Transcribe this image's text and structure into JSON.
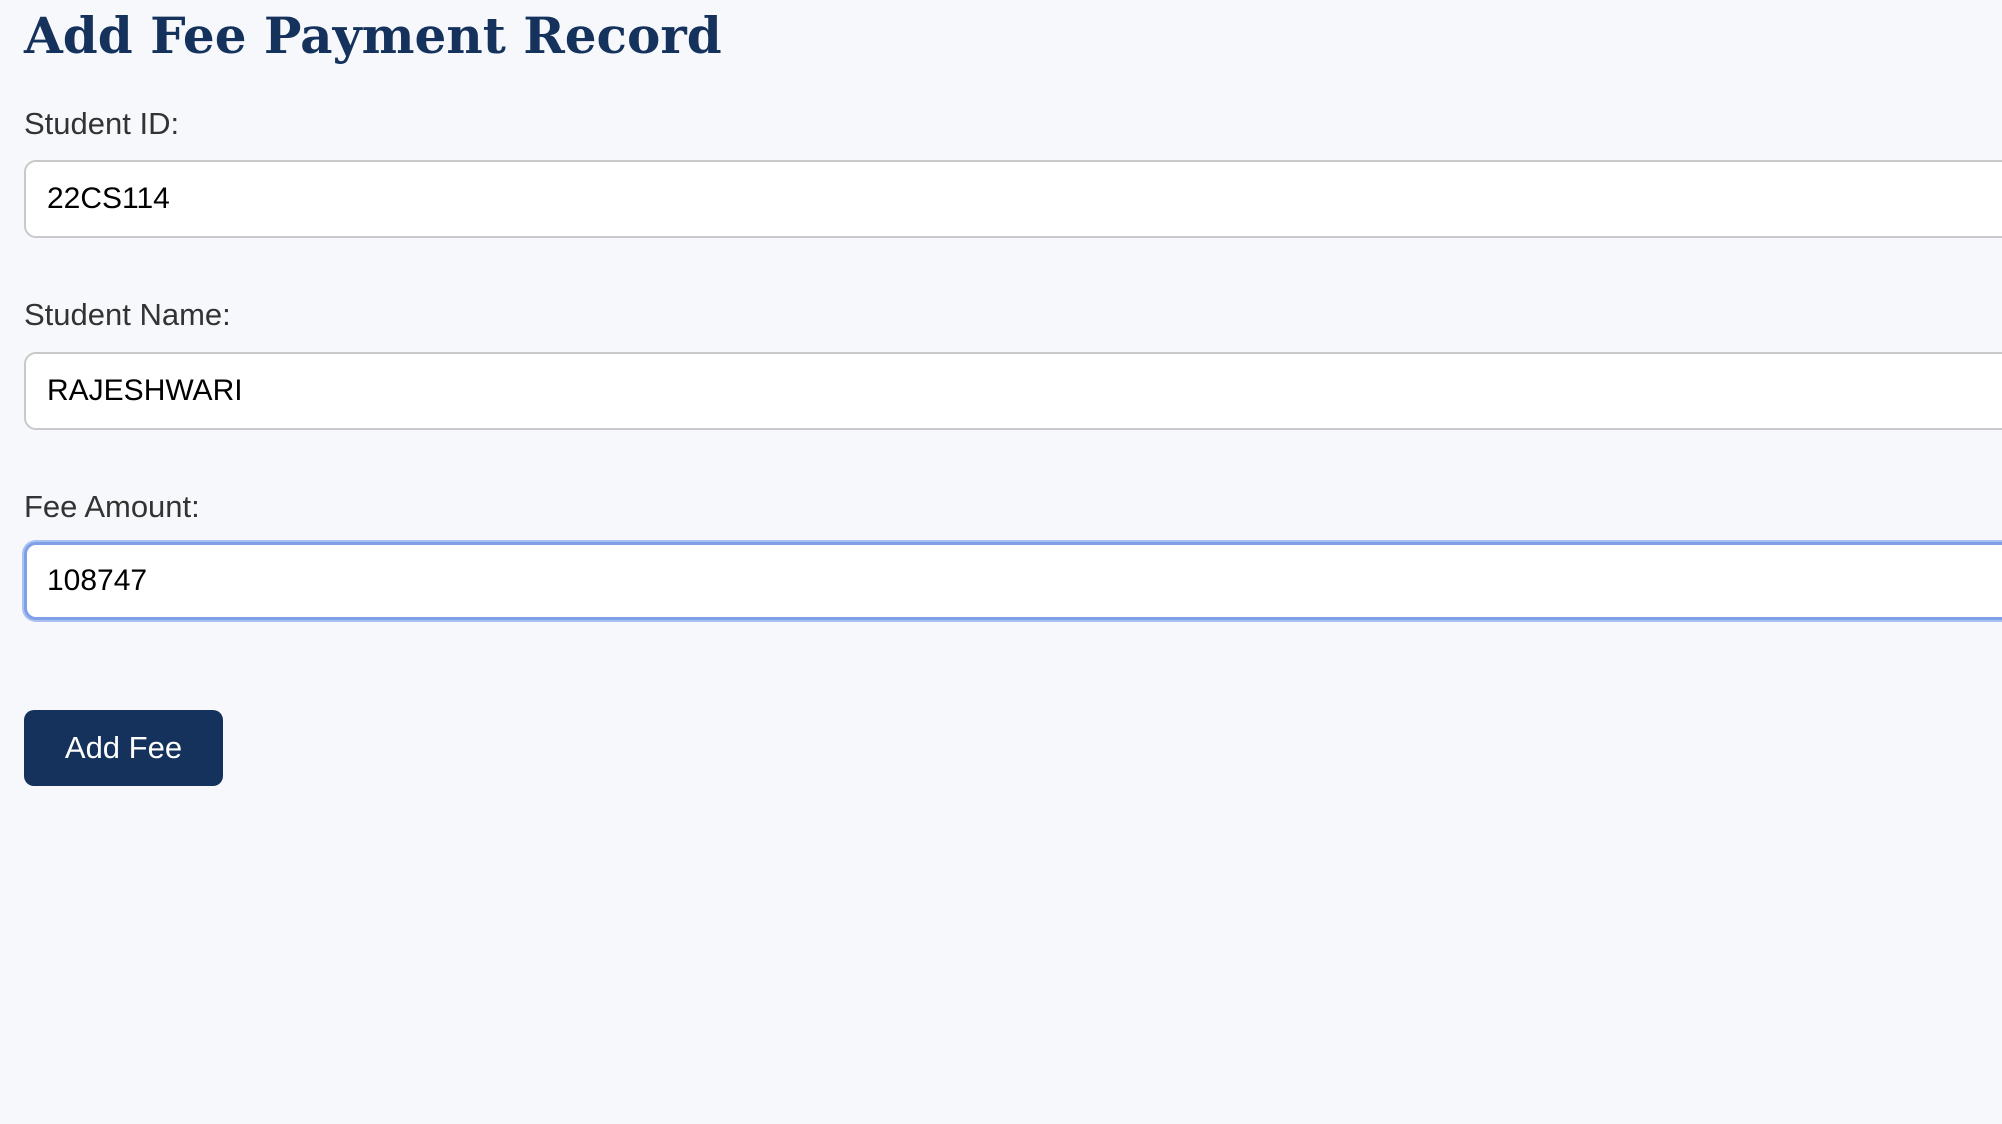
{
  "page": {
    "title": "Add Fee Payment Record"
  },
  "form": {
    "student_id": {
      "label": "Student ID:",
      "value": "22CS114"
    },
    "student_name": {
      "label": "Student Name:",
      "value": "RAJESHWARI"
    },
    "fee_amount": {
      "label": "Fee Amount:",
      "value": "108747",
      "focused": true
    },
    "submit_label": "Add Fee"
  },
  "colors": {
    "background": "#f6f8fb",
    "accent": "#14325c",
    "focus_ring": "#7f9fe6"
  }
}
